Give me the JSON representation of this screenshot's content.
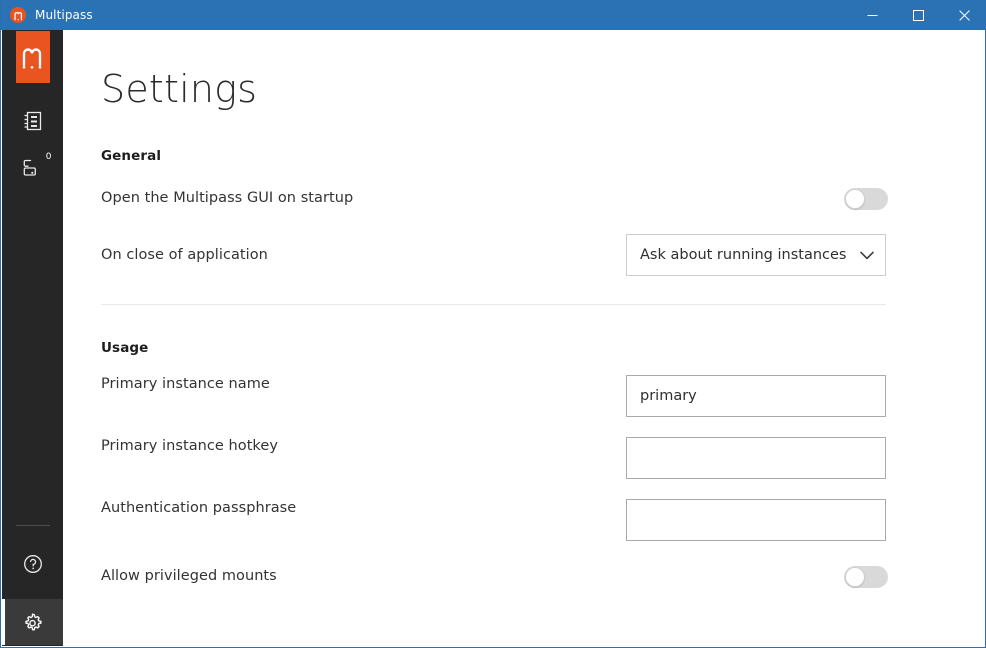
{
  "window": {
    "title": "Multipass",
    "logo_icon": "multipass-logo-icon",
    "controls": {
      "minimize_label": "Minimize",
      "minimize_icon": "minimize-icon",
      "maximize_label": "Maximize",
      "maximize_icon": "maximize-icon",
      "close_label": "Close",
      "close_icon": "close-icon"
    },
    "accent_color": "#2b72b5"
  },
  "sidebar": {
    "background_color": "#262626",
    "brand_color": "#e95420",
    "logo_icon": "multipass-m-logo-icon",
    "items": [
      {
        "name": "catalogue",
        "icon": "catalogue-icon",
        "badge": ""
      },
      {
        "name": "instances",
        "icon": "instances-icon",
        "badge": "0"
      }
    ],
    "bottom_items": [
      {
        "name": "help",
        "icon": "help-circle-icon",
        "selected": false
      },
      {
        "name": "settings",
        "icon": "gear-icon",
        "selected": true
      }
    ]
  },
  "page": {
    "title": "Settings"
  },
  "sections": {
    "general": {
      "header": "General",
      "startup": {
        "label": "Open the Multipass GUI on startup",
        "toggle_on": false
      },
      "on_close": {
        "label": "On close of application",
        "value": "Ask about running instances",
        "chevron_icon": "chevron-down-icon"
      }
    },
    "usage": {
      "header": "Usage",
      "primary_instance_name": {
        "label": "Primary instance name",
        "value": "primary",
        "placeholder": ""
      },
      "primary_instance_hotkey": {
        "label": "Primary instance hotkey",
        "value": "",
        "placeholder": ""
      },
      "authentication_passphrase": {
        "label": "Authentication passphrase",
        "value": "",
        "placeholder": ""
      },
      "privileged_mounts": {
        "label": "Allow privileged mounts",
        "toggle_on": false
      }
    }
  }
}
